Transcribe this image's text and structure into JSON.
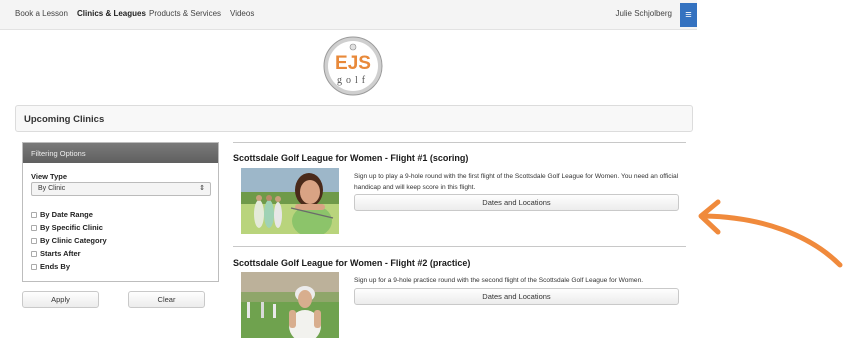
{
  "nav": {
    "items": [
      "Book a Lesson",
      "Clinics & Leagues",
      "Products & Services",
      "Videos"
    ],
    "user": "Julie Schjolberg",
    "menu_glyph": "≡"
  },
  "logo": {
    "initials": "EJS",
    "word": "golf"
  },
  "section": {
    "title": "Upcoming Clinics"
  },
  "filters": {
    "header": "Filtering Options",
    "view_type_label": "View Type",
    "view_type_value": "By Clinic",
    "options": [
      "By Date Range",
      "By Specific Clinic",
      "By Clinic Category",
      "Starts After",
      "Ends By"
    ],
    "apply_label": "Apply",
    "clear_label": "Clear"
  },
  "clinics": [
    {
      "title": "Scottsdale Golf League for Women - Flight #1 (scoring)",
      "description": "Sign up to play a 9-hole round with the first flight of the Scottsdale Golf League for Women. You need an official handicap and will keep score in this flight.",
      "button_label": "Dates and Locations"
    },
    {
      "title": "Scottsdale Golf League for Women - Flight #2 (practice)",
      "description": "Sign up for a 9-hole practice round with the second flight of the Scottsdale Golf League for Women.",
      "button_label": "Dates and Locations"
    }
  ],
  "colors": {
    "accent_blue": "#3472c0",
    "arrow_orange": "#f08a3c",
    "logo_orange": "#e8893a"
  },
  "icons": {
    "menu": "hamburger-icon",
    "select": "up-down-arrow-icon",
    "annotation": "curved-arrow-icon"
  }
}
